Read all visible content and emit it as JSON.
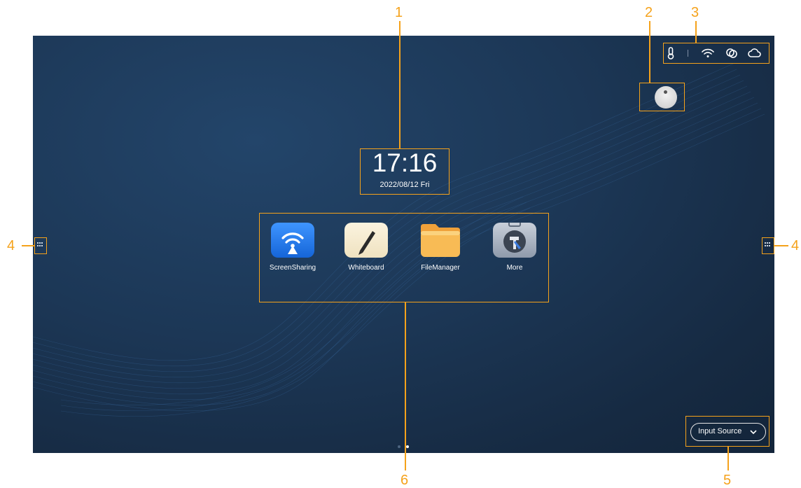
{
  "clock": {
    "time": "17:16",
    "date": "2022/08/12 Fri"
  },
  "apps": [
    {
      "label": "ScreenSharing",
      "icon": "screen-sharing-icon"
    },
    {
      "label": "Whiteboard",
      "icon": "whiteboard-icon"
    },
    {
      "label": "FileManager",
      "icon": "file-manager-icon"
    },
    {
      "label": "More",
      "icon": "more-tools-icon"
    }
  ],
  "status_bar": [
    "thermometer-icon",
    "wifi-icon",
    "link-icon",
    "cloud-icon"
  ],
  "input_source": {
    "label": "Input Source"
  },
  "pagination": {
    "pages": 2,
    "current": 2
  },
  "callouts": {
    "n1": "1",
    "n2": "2",
    "n3": "3",
    "n4_left": "4",
    "n4_right": "4",
    "n5": "5",
    "n6": "6"
  },
  "colors": {
    "callout": "#f5a21b",
    "background": "#1c3756",
    "screen_sharing": "#1e7bf0",
    "file_manager": "#f7b54a"
  }
}
